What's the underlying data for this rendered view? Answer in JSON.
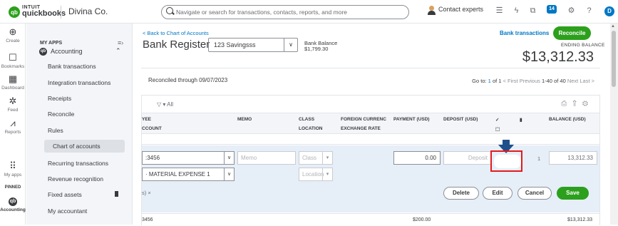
{
  "topbar": {
    "brand_top": "INTUIT",
    "brand_bottom": "quickbooks",
    "company": "Divina Co.",
    "search_placeholder": "Navigate or search for transactions, contacts, reports, and more",
    "contact": "Contact experts",
    "notif_count": "14",
    "avatar": "D"
  },
  "rail": {
    "items": [
      {
        "label": "Create",
        "icon": "⊕"
      },
      {
        "label": "Bookmarks",
        "icon": "☐"
      },
      {
        "label": "Dashboard",
        "icon": "▦"
      },
      {
        "label": "Feed",
        "icon": "✲"
      },
      {
        "label": "Reports",
        "icon": "⩘"
      },
      {
        "label": "My apps",
        "icon": "⠿"
      },
      {
        "label": "PINNED",
        "icon": ""
      },
      {
        "label": "Accounting",
        "icon": "qb"
      }
    ]
  },
  "nav": {
    "section": "MY APPS",
    "app": "Accounting",
    "items": [
      "Bank transactions",
      "Integration transactions",
      "Receipts",
      "Reconcile",
      "Rules",
      "Chart of accounts",
      "Recurring transactions",
      "Revenue recognition",
      "Fixed assets",
      "My accountant"
    ]
  },
  "main": {
    "back_link": "< Back to Chart of Accounts",
    "title": "Bank Register",
    "account": "123 Savingsss",
    "bank_balance_label": "Bank Balance",
    "bank_balance_value": "$1,799.30",
    "bank_transactions_link": "Bank transactions",
    "reconcile_button": "Reconcile",
    "ending_balance_label": "ENDING BALANCE",
    "ending_balance_value": "$13,312.33",
    "reconciled_through": "Reconciled through 09/07/2023",
    "pager": {
      "goto": "Go to:",
      "page": "1",
      "of": "of 1",
      "first": "< First",
      "previous": "Previous",
      "range": "1-40 of 40",
      "next": "Next",
      "last": "Last >"
    },
    "filter": "All",
    "columns": {
      "payee": "YEE",
      "account": "CCOUNT",
      "memo": "MEMO",
      "class": "CLASS",
      "location": "LOCATION",
      "foreign_currency": "FOREIGN CURRENC",
      "exchange_rate": "EXCHANGE RATE",
      "payment": "PAYMENT (USD)",
      "deposit": "DEPOSIT (USD)",
      "check": "✓",
      "attach": "⬚",
      "balance": "BALANCE (USD)"
    },
    "edit_row": {
      "payee_value": ":3456",
      "account_value": "· MATERIAL EXPENSE 1",
      "memo_placeholder": "Memo",
      "class_placeholder": "Class",
      "location_placeholder": "Location",
      "payment_value": "0.00",
      "deposit_placeholder": "Deposit",
      "attach_count": "1",
      "balance_value": "13,312.33",
      "clear_label": "s) ×",
      "delete_button": "Delete",
      "edit_button": "Edit",
      "cancel_button": "Cancel",
      "save_button": "Save"
    },
    "next_row": {
      "payee": "3456",
      "payment": "$200.00",
      "balance": "$13,312.33"
    }
  }
}
